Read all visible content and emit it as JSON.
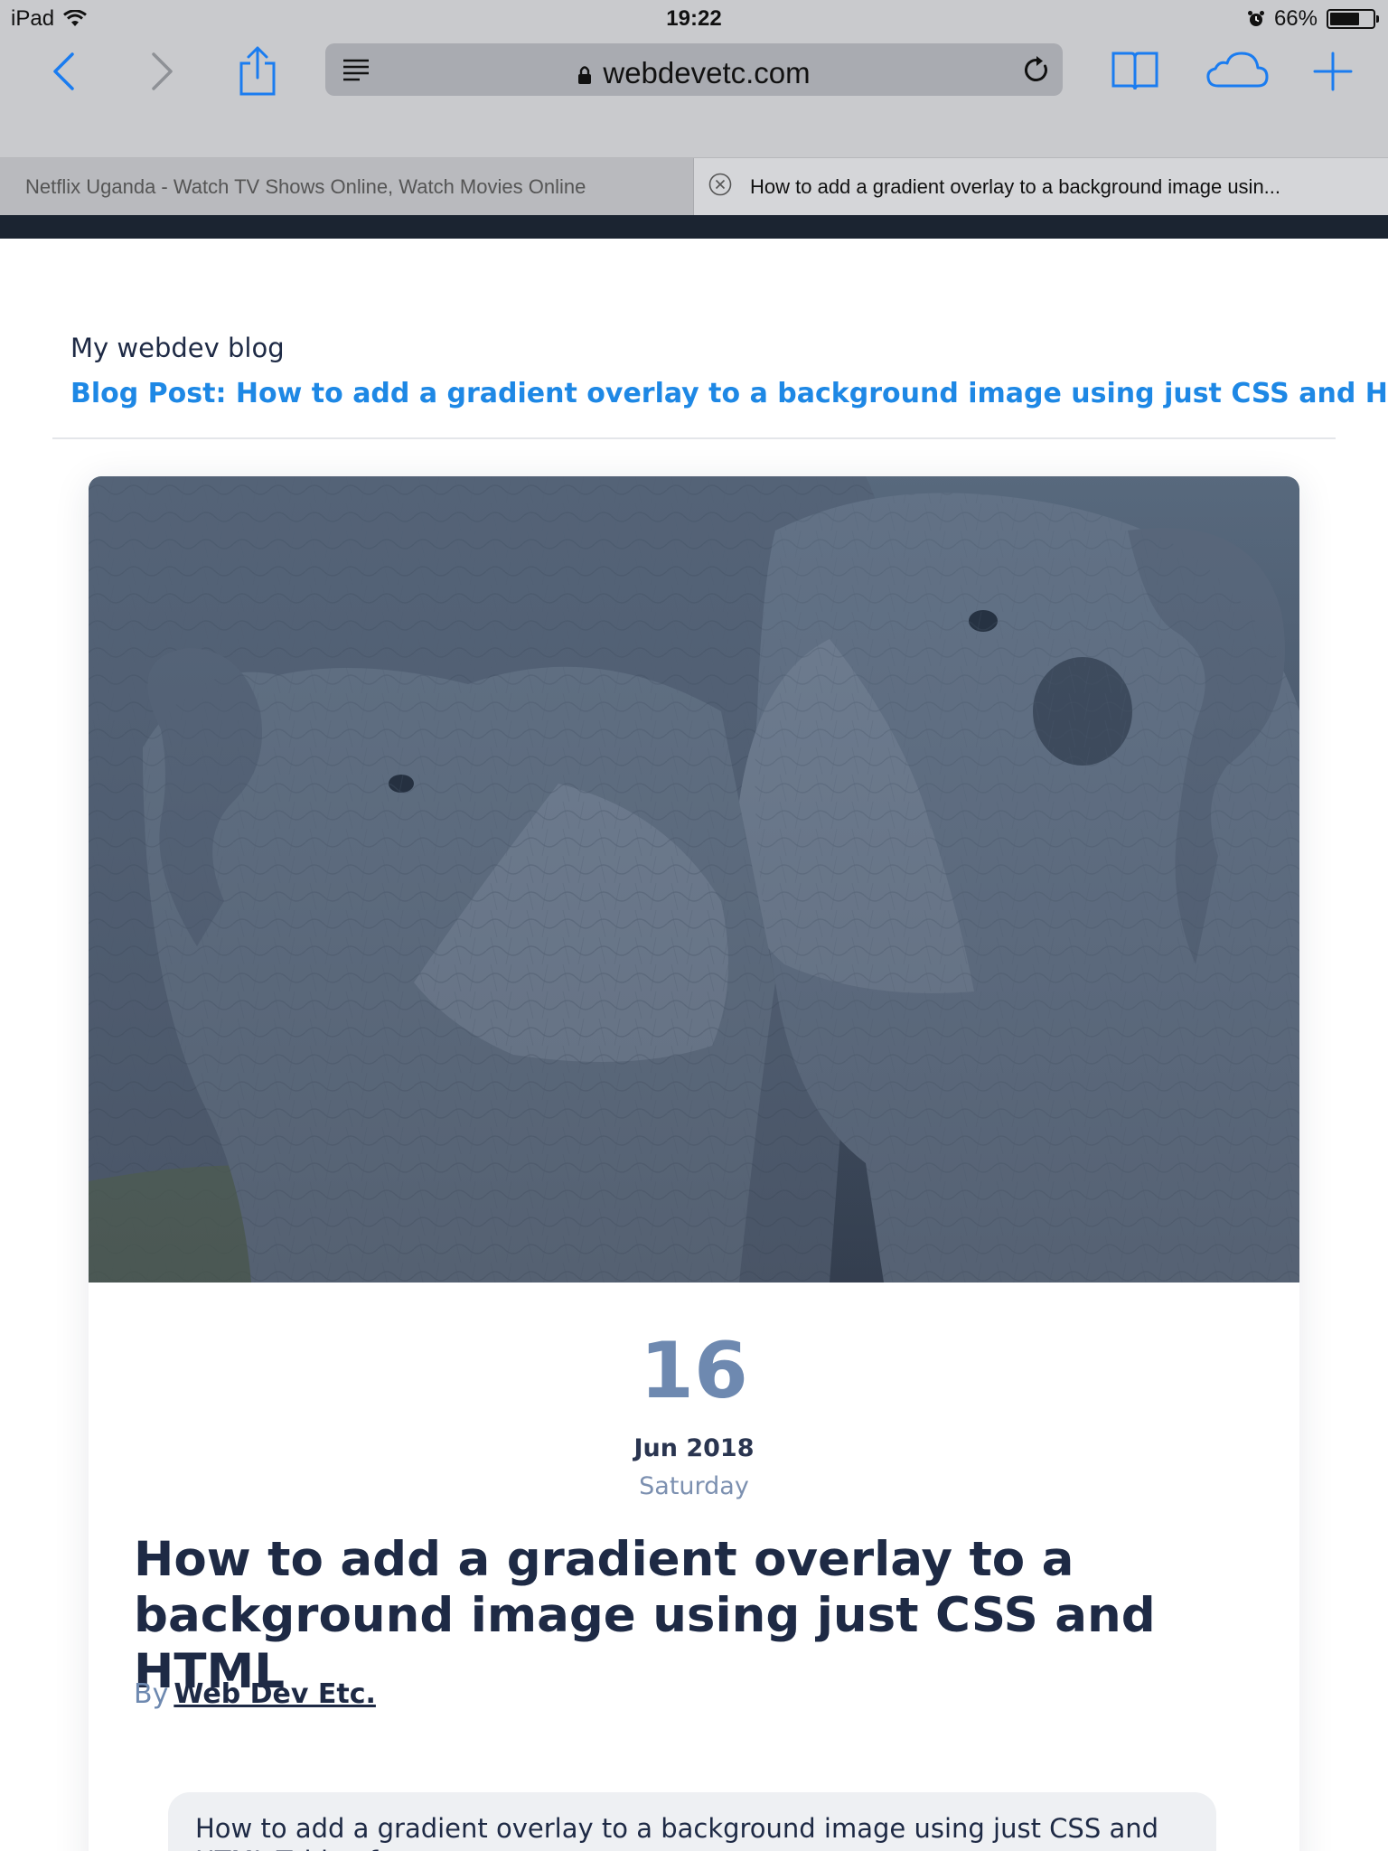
{
  "status": {
    "device": "iPad",
    "time": "19:22",
    "battery": "66%",
    "battery_level": 0.66
  },
  "browser": {
    "domain": "webdevetc.com",
    "icons": {
      "back": "chevron-left-icon",
      "forward": "chevron-right-icon",
      "share": "share-icon",
      "reader": "reader-icon",
      "lock": "lock-icon",
      "reload": "reload-icon",
      "bookmarks": "book-icon",
      "cloud": "cloud-icon",
      "new_tab": "plus-icon"
    },
    "accent_color": "#1a7cf0"
  },
  "tabs": [
    {
      "title": "Netflix Uganda - Watch TV Shows Online, Watch Movies Online",
      "active": false
    },
    {
      "title": "How to add a gradient overlay to a background image usin...",
      "active": true
    }
  ],
  "page": {
    "site_title": "My webdev blog",
    "breadcrumb": "Blog Post: How to add a gradient overlay to a background image using just CSS and HTML",
    "date_day": "16",
    "date_month_year": "Jun 2018",
    "date_weekday": "Saturday",
    "post_title": "How to add a gradient overlay to a background image using just CSS and HTML",
    "by_label": "By",
    "author": "Web Dev Etc.",
    "toc_text": "How to add a gradient overlay to a background image using just CSS and HTML Table of contents"
  },
  "colors": {
    "link": "#1e88e5",
    "heading": "#1e2a45",
    "date_accent": "#6e89b0",
    "nav_dark": "#1b2431"
  }
}
